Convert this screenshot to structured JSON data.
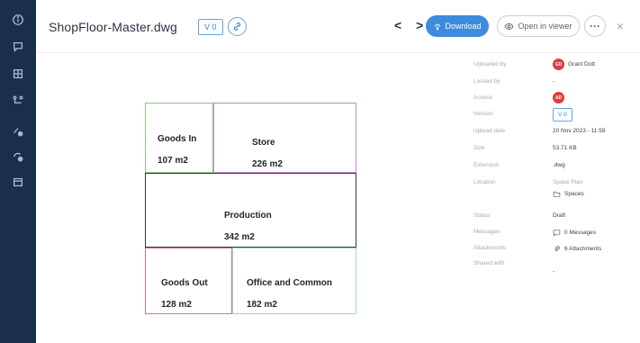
{
  "header": {
    "filename": "ShopFloor-Master.dwg",
    "version_tag": "V 0",
    "nav_arrows": "< >",
    "download_label": "Download",
    "open_viewer_label": "Open in viewer",
    "more_label": "···",
    "close_label": "×"
  },
  "sidebar": {
    "icons": [
      "info-icon",
      "comment-icon",
      "grid-icon",
      "flow-icon",
      "settings-icon",
      "settings-alt-icon",
      "calendar-icon"
    ]
  },
  "floor_plan": {
    "rooms": [
      {
        "name": "Goods In",
        "area": "107 m2",
        "color": "#8cc584"
      },
      {
        "name": "Store",
        "area": "226 m2",
        "color": "#c98bc9"
      },
      {
        "name": "Production",
        "area": "342 m2",
        "color": "#3a3a3a"
      },
      {
        "name": "Goods Out",
        "area": "128 m2",
        "color": "#d5737b"
      },
      {
        "name": "Office and Common",
        "area": "182 m2",
        "color": "#9fd3e6"
      }
    ]
  },
  "info_panel": {
    "uploaded_by": {
      "label": "Uploaded by",
      "initials": "GD",
      "value": "Grant Dott"
    },
    "locked_by": {
      "label": "Locked by",
      "value": "-"
    },
    "access": {
      "label": "Access",
      "initials": "AD"
    },
    "version": {
      "label": "Version",
      "value": "V 0"
    },
    "upload_date": {
      "label": "Upload date",
      "value": "20 Nov 2023 - 11:59"
    },
    "size": {
      "label": "Size",
      "value": "53.71 KB"
    },
    "extension": {
      "label": "Extension",
      "value": ".dwg"
    },
    "location": {
      "label": "Location",
      "value": "Space Plan",
      "sub_value": "Spaces"
    },
    "status": {
      "label": "Status",
      "value": "Draft"
    },
    "messages": {
      "label": "Messages",
      "value": "0 Messages"
    },
    "attachments": {
      "label": "Attachments",
      "value": "6 Attachments"
    },
    "shared_with": {
      "label": "Shared with",
      "value": "-"
    }
  },
  "colors": {
    "rail": "#1b2f4d",
    "accent": "#3d8bdc",
    "avatar": "#e5393d"
  }
}
